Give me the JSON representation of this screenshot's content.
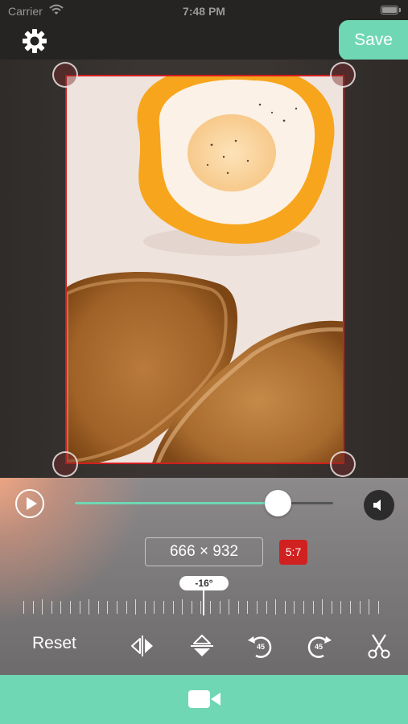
{
  "status_bar": {
    "carrier": "Carrier",
    "time": "7:48 PM"
  },
  "header": {
    "save_label": "Save"
  },
  "editor": {
    "dimensions": "666 × 932",
    "aspect_ratio": "5:7",
    "rotation_angle": "-16°",
    "playback_progress": 0.785
  },
  "toolbar": {
    "reset_label": "Reset",
    "rotate_ccw_label": "45",
    "rotate_cw_label": "45"
  },
  "colors": {
    "accent": "#6fd7b4",
    "crop_border": "#d21e1e",
    "ratio_badge": "#d12020"
  },
  "icons": {
    "settings": "gear-icon",
    "play": "play-icon",
    "volume": "speaker-icon",
    "flip_h": "flip-horizontal-icon",
    "flip_v": "flip-vertical-icon",
    "rotate_ccw": "rotate-left-45-icon",
    "rotate_cw": "rotate-right-45-icon",
    "trim": "scissors-icon",
    "video": "video-camera-icon"
  }
}
